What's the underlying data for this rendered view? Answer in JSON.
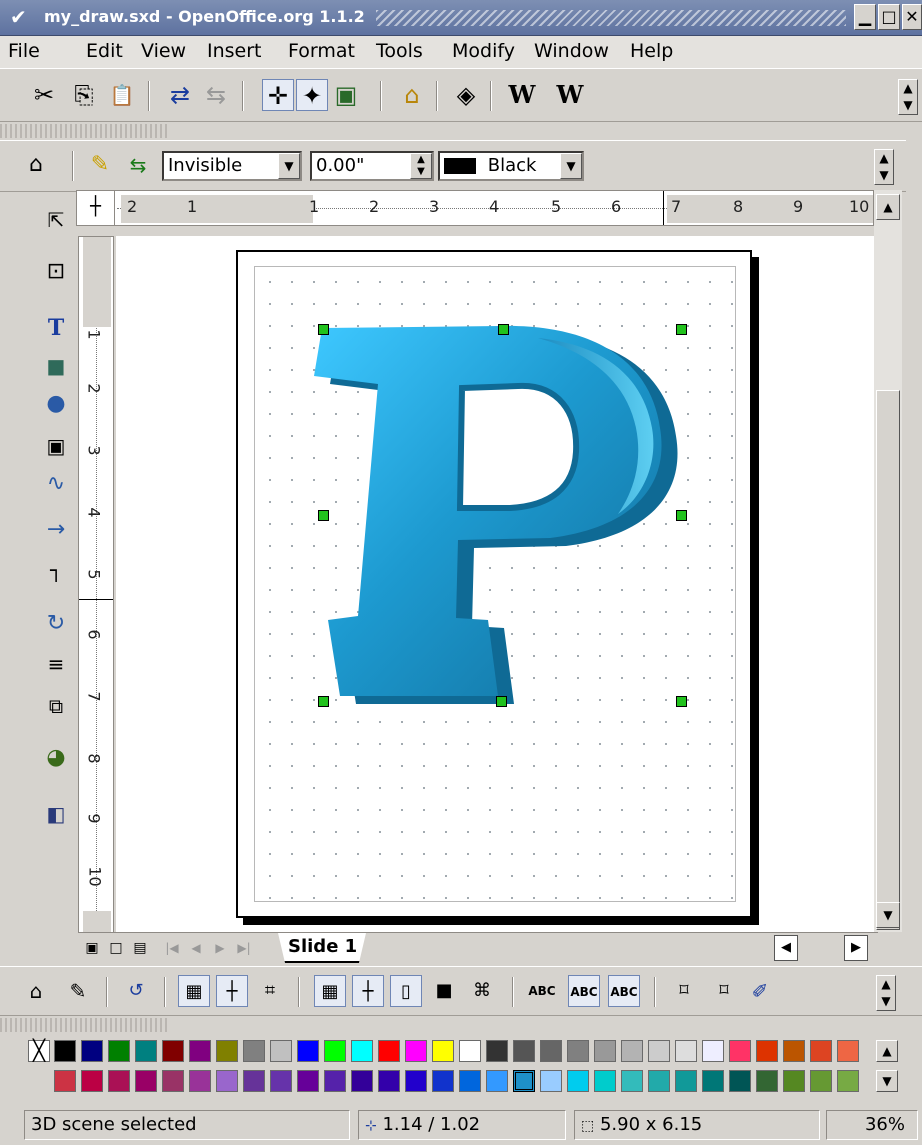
{
  "window": {
    "title": "my_draw.sxd - OpenOffice.org 1.1.2"
  },
  "menu": [
    "File",
    "Edit",
    "View",
    "Insert",
    "Format",
    "Tools",
    "Modify",
    "Window",
    "Help"
  ],
  "menu_underline": [
    "F",
    "E",
    "V",
    "I",
    "o",
    "T",
    "M",
    "W",
    "H"
  ],
  "standard_toolbar": {
    "icons": [
      "cut-icon",
      "copy-icon",
      "paste-icon",
      "undo-icon",
      "redo-icon",
      "snap-icon",
      "navigator-icon",
      "gallery-icon",
      "insert-image-icon",
      "extrusion-icon",
      "fontwork-icon",
      "macro-icon"
    ],
    "glyphs": [
      "✂",
      "⎘",
      "📋",
      "⇄",
      "⇆",
      "✛",
      "✦",
      "▣",
      "⌂",
      "◈",
      "W",
      "W"
    ]
  },
  "object_bar": {
    "line_style": "Invisible",
    "line_width": "0.00\"",
    "line_color": "Black"
  },
  "rulers": {
    "h_labels": [
      "2",
      "1",
      "1",
      "2",
      "3",
      "4",
      "5",
      "6",
      "7",
      "8",
      "9",
      "10"
    ],
    "v_labels": [
      "1",
      "2",
      "3",
      "4",
      "5",
      "6",
      "7",
      "8",
      "9",
      "10"
    ]
  },
  "slide": {
    "tab_label": "Slide 1"
  },
  "drawing": {
    "letter": "P",
    "letter_color": "#1d9ad0"
  },
  "palette": {
    "row1": [
      "#000000",
      "#000080",
      "#008000",
      "#008080",
      "#800000",
      "#800080",
      "#808000",
      "#808080",
      "#c0c0c0",
      "#0000ff",
      "#00ff00",
      "#00ffff",
      "#ff0000",
      "#ff00ff",
      "#ffff00",
      "#ffffff",
      "#333333",
      "#555555",
      "#666666",
      "#808080",
      "#999999",
      "#b3b3b3",
      "#cccccc",
      "#dddddd",
      "#eeeeff",
      "#ff3366",
      "#dd3300",
      "#bb5500",
      "#dd4422",
      "#ee6644"
    ],
    "row2": [
      "#cc3344",
      "#bb0044",
      "#aa1155",
      "#990066",
      "#993366",
      "#993399",
      "#9966cc",
      "#663399",
      "#6633aa",
      "#660099",
      "#5522aa",
      "#330099",
      "#3300aa",
      "#2200cc",
      "#1133cc",
      "#0066dd",
      "#3399ff",
      "#1e90c8",
      "#99ccff",
      "#00ccee",
      "#00cccc",
      "#33bbbb",
      "#22aaaa",
      "#119999",
      "#007777",
      "#005555",
      "#336633",
      "#558822",
      "#669933",
      "#77aa44"
    ],
    "selected": "#1e90c8"
  },
  "status": {
    "message": "3D scene selected",
    "position": "1.14 / 1.02",
    "size": "5.90 x 6.15",
    "zoom": "36%"
  }
}
